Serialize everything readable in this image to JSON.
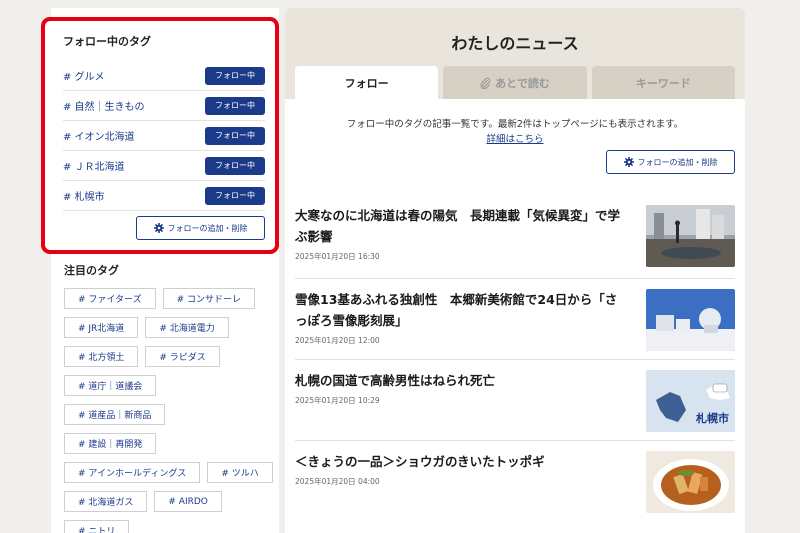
{
  "followed": {
    "title": "フォロー中のタグ",
    "tags": [
      {
        "label": "# グルメ",
        "button": "フォロー中"
      },
      {
        "label": "# 自然｜生きもの",
        "button": "フォロー中"
      },
      {
        "label": "# イオン北海道",
        "button": "フォロー中"
      },
      {
        "label": "# ＪＲ北海道",
        "button": "フォロー中"
      },
      {
        "label": "# 札幌市",
        "button": "フォロー中"
      }
    ],
    "manage_label": "フォローの追加・削除"
  },
  "popular": {
    "title": "注目のタグ",
    "tags": [
      "# ファイターズ",
      "# コンサドーレ",
      "# JR北海道",
      "# 北海道電力",
      "# 北方領土",
      "# ラピダス",
      "# 道庁｜道議会",
      "# 道産品｜新商品",
      "# 建設｜再開発",
      "# アインホールディングス",
      "# ツルハ",
      "# 北海道ガス",
      "# AIRDO",
      "# ニトリ"
    ]
  },
  "main": {
    "title": "わたしのニュース",
    "tabs": [
      {
        "label": "フォロー",
        "active": true
      },
      {
        "label": "あとで読む",
        "active": false,
        "icon": "paperclip-icon"
      },
      {
        "label": "キーワード",
        "active": false
      }
    ],
    "notice": "フォロー中のタグの記事一覧です。最新2件はトップページにも表示されます。",
    "notice_link": "詳細はこちら",
    "manage_label": "フォローの追加・削除",
    "articles": [
      {
        "title": "大寒なのに北海道は春の陽気　長期連載「気候異変」で学ぶ影響",
        "date": "2025年01月20日 16:30"
      },
      {
        "title": "雪像13基あふれる独創性　本郷新美術館で24日から「さっぽろ雪像彫刻展」",
        "date": "2025年01月20日 12:00"
      },
      {
        "title": "札幌の国道で高齢男性はねられ死亡",
        "date": "2025年01月20日 10:29",
        "thumb_label": "札幌市"
      },
      {
        "title": "＜きょうの一品＞ショウガのきいたトッポギ",
        "date": "2025年01月20日 04:00"
      }
    ]
  },
  "colors": {
    "brand": "#1b3a8a",
    "highlight": "#e60012",
    "panel": "#e9e5dd"
  }
}
